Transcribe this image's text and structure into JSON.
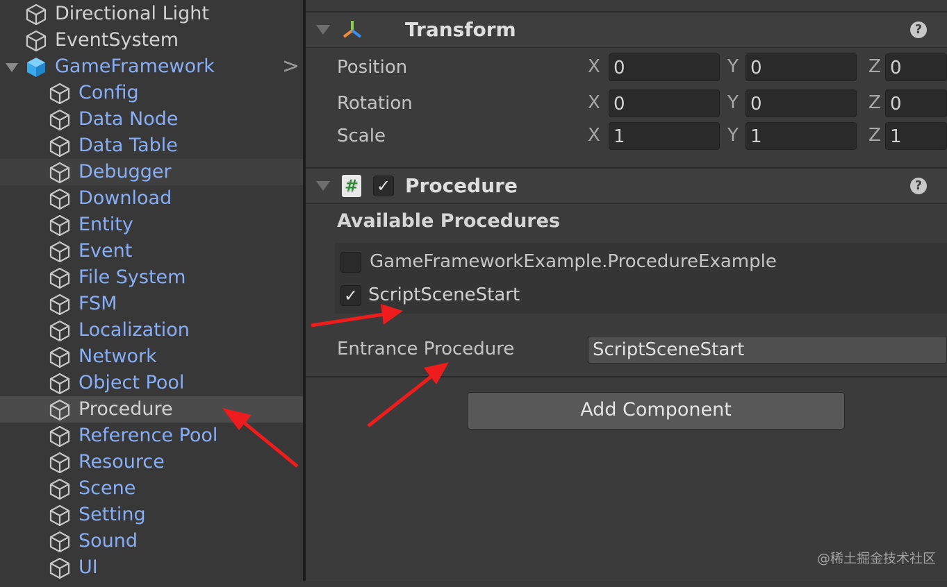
{
  "hierarchy": {
    "items": [
      {
        "label": "Directional Light",
        "color": "white",
        "indent": 1,
        "hover": false,
        "selected": false
      },
      {
        "label": "EventSystem",
        "color": "white",
        "indent": 1,
        "hover": false,
        "selected": false
      },
      {
        "label": "GameFramework",
        "color": "blue",
        "indent": 1,
        "hover": false,
        "selected": false,
        "expanded": true,
        "prefab_root": true
      },
      {
        "label": "Config",
        "color": "blue",
        "indent": 2,
        "hover": false,
        "selected": false
      },
      {
        "label": "Data Node",
        "color": "blue",
        "indent": 2,
        "hover": false,
        "selected": false
      },
      {
        "label": "Data Table",
        "color": "blue",
        "indent": 2,
        "hover": false,
        "selected": false
      },
      {
        "label": "Debugger",
        "color": "blue",
        "indent": 2,
        "hover": true,
        "selected": false
      },
      {
        "label": "Download",
        "color": "blue",
        "indent": 2,
        "hover": false,
        "selected": false
      },
      {
        "label": "Entity",
        "color": "blue",
        "indent": 2,
        "hover": false,
        "selected": false
      },
      {
        "label": "Event",
        "color": "blue",
        "indent": 2,
        "hover": false,
        "selected": false
      },
      {
        "label": "File System",
        "color": "blue",
        "indent": 2,
        "hover": false,
        "selected": false
      },
      {
        "label": "FSM",
        "color": "blue",
        "indent": 2,
        "hover": false,
        "selected": false
      },
      {
        "label": "Localization",
        "color": "blue",
        "indent": 2,
        "hover": false,
        "selected": false
      },
      {
        "label": "Network",
        "color": "blue",
        "indent": 2,
        "hover": false,
        "selected": false
      },
      {
        "label": "Object Pool",
        "color": "blue",
        "indent": 2,
        "hover": false,
        "selected": false
      },
      {
        "label": "Procedure",
        "color": "white",
        "indent": 2,
        "hover": false,
        "selected": true
      },
      {
        "label": "Reference Pool",
        "color": "blue",
        "indent": 2,
        "hover": false,
        "selected": false
      },
      {
        "label": "Resource",
        "color": "blue",
        "indent": 2,
        "hover": false,
        "selected": false
      },
      {
        "label": "Scene",
        "color": "blue",
        "indent": 2,
        "hover": false,
        "selected": false
      },
      {
        "label": "Setting",
        "color": "blue",
        "indent": 2,
        "hover": false,
        "selected": false
      },
      {
        "label": "Sound",
        "color": "blue",
        "indent": 2,
        "hover": false,
        "selected": false
      },
      {
        "label": "UI",
        "color": "blue",
        "indent": 2,
        "hover": false,
        "selected": false
      }
    ],
    "expand_chevron": ">"
  },
  "transform": {
    "title": "Transform",
    "help": "?",
    "menu": "⋮",
    "rows": [
      {
        "label": "Position",
        "x": "0",
        "y": "0",
        "z": "0"
      },
      {
        "label": "Rotation",
        "x": "0",
        "y": "0",
        "z": "0"
      },
      {
        "label": "Scale",
        "x": "1",
        "y": "1",
        "z": "1"
      }
    ],
    "axes": {
      "x": "X",
      "y": "Y",
      "z": "Z"
    }
  },
  "procedure": {
    "title": "Procedure",
    "script_icon": "#",
    "enabled_check": "✓",
    "help": "?",
    "menu": "⋮",
    "available_label": "Available Procedures",
    "available": [
      {
        "name": "GameFrameworkExample.ProcedureExample",
        "checked": false
      },
      {
        "name": "ScriptSceneStart",
        "checked": true
      }
    ],
    "entrance_label": "Entrance Procedure",
    "entrance_value": "ScriptSceneStart",
    "check_glyph": "✓"
  },
  "add_component_label": "Add Component",
  "watermark": "@稀土掘金技术社区",
  "colors": {
    "accent_blue": "#88aef5",
    "arrow_red": "#ee1c1c",
    "panel_bg": "#383838"
  }
}
